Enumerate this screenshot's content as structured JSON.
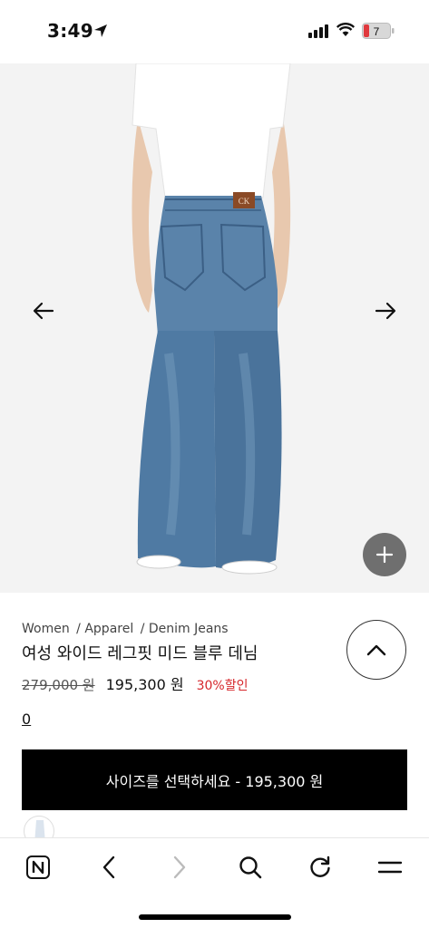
{
  "status_bar": {
    "time": "3:49",
    "battery_level": "7",
    "icons": [
      "location-arrow-icon",
      "cellular-signal-icon",
      "wifi-icon",
      "battery-icon"
    ]
  },
  "product_image": {
    "prev_icon": "arrow-left-icon",
    "next_icon": "arrow-right-icon",
    "zoom_icon": "plus-icon",
    "label_text": "CK"
  },
  "breadcrumb": {
    "items": [
      "Women",
      "/ Apparel",
      "/ Denim Jeans"
    ]
  },
  "product": {
    "title": "여성 와이드 레그핏 미드 블루 데님",
    "price_original": "279,000 원",
    "price_sale": "195,300 원",
    "discount": "30%할인",
    "review_count": "0"
  },
  "actions": {
    "add_to_cart_label": "사이즈를 선택하세요 - 195,300 원",
    "collapse_icon": "chevron-up-icon"
  },
  "browser_toolbar": {
    "buttons": [
      "naver-home-icon",
      "back-icon",
      "forward-icon",
      "search-icon",
      "refresh-icon",
      "menu-icon"
    ]
  },
  "colors": {
    "accent_discount": "#d6262b",
    "button_bg": "#000000",
    "denim": "#4f7aa3"
  }
}
